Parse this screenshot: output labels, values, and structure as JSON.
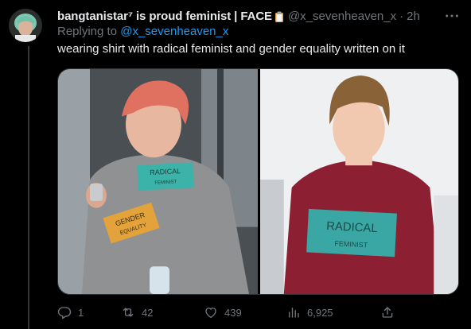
{
  "tweet": {
    "display_name": "bangtanistar⁷ is proud feminist | FACE",
    "handle": "@x_sevenheaven_x",
    "separator": "·",
    "time": "2h",
    "replying_prefix": "Replying to ",
    "replying_to": "@x_sevenheaven_x",
    "text": "wearing shirt with radical feminist and gender equality written on it"
  },
  "media": {
    "left_badges": {
      "badge1_line1": "RADICAL",
      "badge1_line2": "FEMINIST",
      "badge2_line1": "GENDER",
      "badge2_line2": "EQUALITY"
    },
    "right_badge": {
      "line1": "RADICAL",
      "line2": "FEMINIST"
    }
  },
  "actions": {
    "replies": "1",
    "retweets": "42",
    "likes": "439",
    "views": "6,925"
  },
  "icons": [
    "avatar",
    "clipboard-icon",
    "more-icon",
    "reply-icon",
    "retweet-icon",
    "like-icon",
    "views-icon",
    "share-icon"
  ],
  "colors": {
    "background": "#000000",
    "text": "#e7e9ea",
    "muted": "#71767b",
    "link": "#1d9bf0",
    "thread_line": "#333639"
  }
}
